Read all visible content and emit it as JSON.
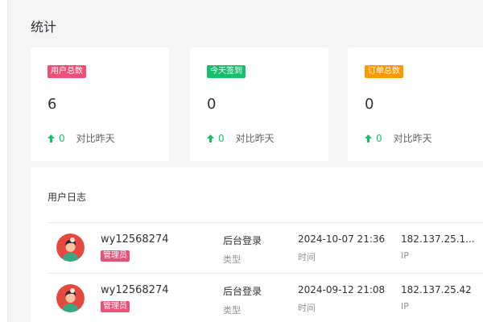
{
  "page": {
    "title": "统计"
  },
  "stats": [
    {
      "badge": "用户总数",
      "badge_color": "#ed4f77",
      "value": "6",
      "trend": "0",
      "trend_label": "对比昨天"
    },
    {
      "badge": "今天签到",
      "badge_color": "#19be6b",
      "value": "0",
      "trend": "0",
      "trend_label": "对比昨天"
    },
    {
      "badge": "订单总数",
      "badge_color": "#ff9900",
      "value": "0",
      "trend": "0",
      "trend_label": "对比昨天"
    }
  ],
  "log": {
    "title": "用户日志",
    "rows": [
      {
        "username": "wy12568274",
        "role": "管理员",
        "type": "后台登录",
        "type_label": "类型",
        "time": "2024-10-07 21:36",
        "time_label": "时间",
        "ip": "182.137.25.1...",
        "ip_label": "IP"
      },
      {
        "username": "wy12568274",
        "role": "管理员",
        "type": "后台登录",
        "type_label": "类型",
        "time": "2024-09-12 21:08",
        "time_label": "时间",
        "ip": "182.137.25.42",
        "ip_label": "IP"
      }
    ]
  },
  "colors": {
    "trend_up": "#19be6b",
    "role_badge": "#ed4f77"
  },
  "icons": {
    "trend": "arrow-up-icon",
    "avatar": "user-avatar-icon"
  }
}
